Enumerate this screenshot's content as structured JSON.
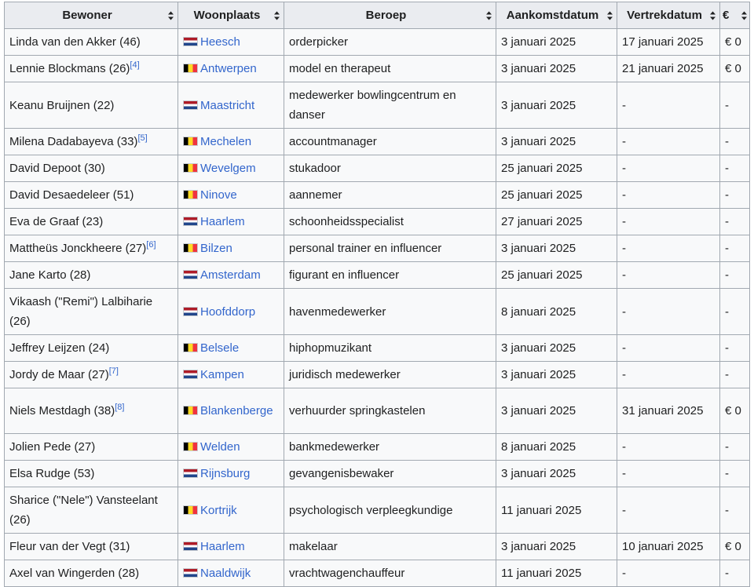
{
  "headers": [
    "Bewoner",
    "Woonplaats",
    "Beroep",
    "Aankomstdatum",
    "Vertrekdatum",
    "€"
  ],
  "rows": [
    {
      "name": "Linda van den Akker (46)",
      "ref": "",
      "flag": "nl",
      "place": "Heesch",
      "job": "orderpicker",
      "arrival": "3 januari 2025",
      "departure": "17 januari 2025",
      "money": "€ 0"
    },
    {
      "name": "Lennie Blockmans (26)",
      "ref": "[4]",
      "flag": "be",
      "place": "Antwerpen",
      "job": "model en therapeut",
      "arrival": "3 januari 2025",
      "departure": "21 januari 2025",
      "money": "€ 0"
    },
    {
      "name": "Keanu Bruijnen (22)",
      "ref": "",
      "flag": "nl",
      "place": "Maastricht",
      "job": "medewerker bowlingcentrum en danser",
      "arrival": "3 januari 2025",
      "departure": "-",
      "money": "-"
    },
    {
      "name": "Milena Dadabayeva (33)",
      "ref": "[5]",
      "flag": "be",
      "place": "Mechelen",
      "job": "accountmanager",
      "arrival": "3 januari 2025",
      "departure": "-",
      "money": "-"
    },
    {
      "name": "David Depoot (30)",
      "ref": "",
      "flag": "be",
      "place": "Wevelgem",
      "job": "stukadoor",
      "arrival": "25 januari 2025",
      "departure": "-",
      "money": "-"
    },
    {
      "name": "David Desaedeleer (51)",
      "ref": "",
      "flag": "be",
      "place": "Ninove",
      "job": "aannemer",
      "arrival": "25 januari 2025",
      "departure": "-",
      "money": "-"
    },
    {
      "name": "Eva de Graaf (23)",
      "ref": "",
      "flag": "nl",
      "place": "Haarlem",
      "job": "schoonheidsspecialist",
      "arrival": "27 januari 2025",
      "departure": "-",
      "money": "-"
    },
    {
      "name": "Mattheüs Jonckheere (27)",
      "ref": "[6]",
      "flag": "be",
      "place": "Bilzen",
      "job": "personal trainer en influencer",
      "arrival": "3 januari 2025",
      "departure": "-",
      "money": "-"
    },
    {
      "name": "Jane Karto (28)",
      "ref": "",
      "flag": "nl",
      "place": "Amsterdam",
      "job": "figurant en influencer",
      "arrival": "25 januari 2025",
      "departure": "-",
      "money": "-"
    },
    {
      "name": "Vikaash (\"Remi\") Lalbiharie (26)",
      "ref": "",
      "flag": "nl",
      "place": "Hoofddorp",
      "job": "havenmedewerker",
      "arrival": "8 januari 2025",
      "departure": "-",
      "money": "-"
    },
    {
      "name": "Jeffrey Leijzen (24)",
      "ref": "",
      "flag": "be",
      "place": "Belsele",
      "job": "hiphopmuzikant",
      "arrival": "3 januari 2025",
      "departure": "-",
      "money": "-"
    },
    {
      "name": "Jordy de Maar (27)",
      "ref": "[7]",
      "flag": "nl",
      "place": "Kampen",
      "job": "juridisch medewerker",
      "arrival": "3 januari 2025",
      "departure": "-",
      "money": "-"
    },
    {
      "name": "Niels Mestdagh (38)",
      "ref": "[8]",
      "flag": "be",
      "place": "Blankenberge",
      "job": "verhuurder springkastelen",
      "arrival": "3 januari 2025",
      "departure": "31 januari 2025",
      "money": "€ 0"
    },
    {
      "name": "Jolien Pede (27)",
      "ref": "",
      "flag": "be",
      "place": "Welden",
      "job": "bankmedewerker",
      "arrival": "8 januari 2025",
      "departure": "-",
      "money": "-"
    },
    {
      "name": "Elsa Rudge (53)",
      "ref": "",
      "flag": "nl",
      "place": "Rijnsburg",
      "job": "gevangenisbewaker",
      "arrival": "3 januari 2025",
      "departure": "-",
      "money": "-"
    },
    {
      "name": "Sharice (\"Nele\") Vansteelant (26)",
      "ref": "",
      "flag": "be",
      "place": "Kortrijk",
      "job": "psychologisch verpleegkundige",
      "arrival": "11 januari 2025",
      "departure": "-",
      "money": "-"
    },
    {
      "name": "Fleur van der Vegt (31)",
      "ref": "",
      "flag": "nl",
      "place": "Haarlem",
      "job": "makelaar",
      "arrival": "3 januari 2025",
      "departure": "10 januari 2025",
      "money": "€ 0"
    },
    {
      "name": "Axel van Wingerden (28)",
      "ref": "",
      "flag": "nl",
      "place": "Naaldwijk",
      "job": "vrachtwagenchauffeur",
      "arrival": "11 januari 2025",
      "departure": "-",
      "money": "-"
    }
  ]
}
